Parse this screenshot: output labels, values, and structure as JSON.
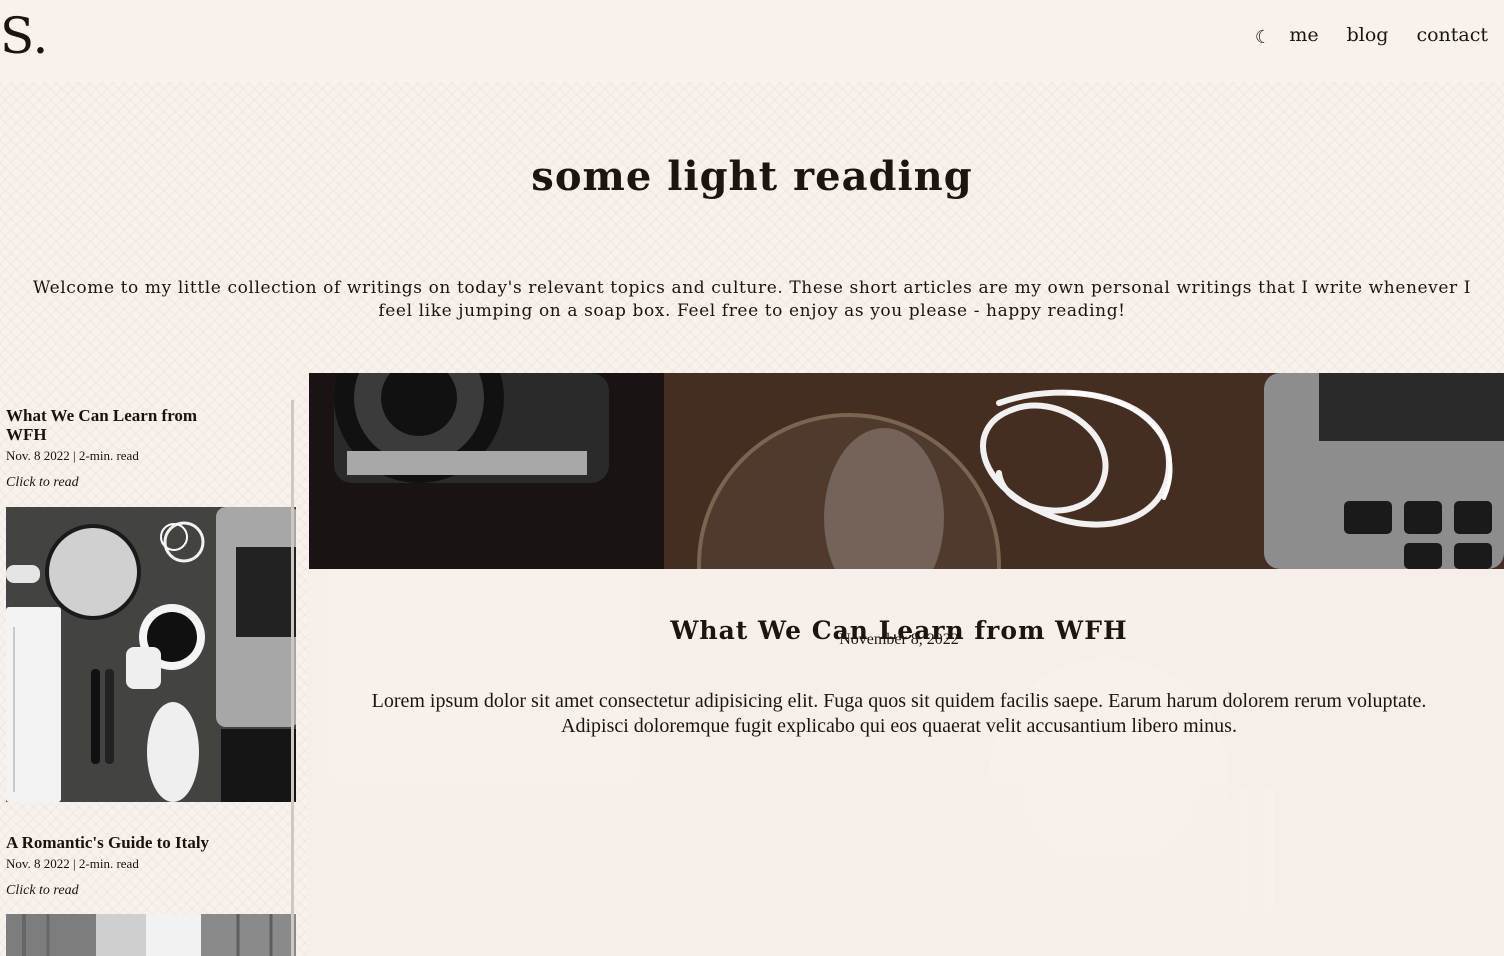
{
  "site": {
    "logo": "S.",
    "theme_toggle_icon": "moon-icon",
    "nav": [
      {
        "label": "me"
      },
      {
        "label": "blog"
      },
      {
        "label": "contact"
      }
    ]
  },
  "hero": {
    "title": "some light reading",
    "intro": "Welcome to my little collection of writings on today's relevant topics and culture. These short articles are my own personal writings that I write whenever I feel like jumping on a soap box. Feel free to enjoy as you please - happy reading!"
  },
  "sidebar": {
    "posts": [
      {
        "title": "What We Can Learn from WFH",
        "meta": "Nov. 8 2022 | 2-min. read",
        "link": "Click to read",
        "thumbnail": "desk-workspace-photo"
      },
      {
        "title": "A Romantic's Guide to Italy",
        "meta": "Nov. 8 2022 | 2-min. read",
        "link": "Click to read",
        "thumbnail": "italy-street-photo"
      }
    ]
  },
  "article": {
    "title": "What We Can Learn from WFH",
    "date": "November 8, 2022",
    "body": "Lorem ipsum dolor sit amet consectetur adipisicing elit. Fuga quos sit quidem facilis saepe. Earum harum dolorem rerum voluptate. Adipisci doloremque fugit explicabo qui eos quaerat velit accusantium libero minus.",
    "hero_image": "desk-camera-laptop-photo"
  },
  "colors": {
    "background": "#f8f1ec",
    "text": "#1c140f"
  }
}
